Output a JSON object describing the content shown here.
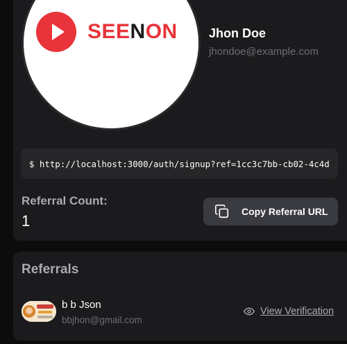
{
  "profile": {
    "logo": {
      "text_red_1": "SEE",
      "text_dark": "N",
      "text_red_2": "ON"
    },
    "name": "Jhon Doe",
    "email": "jhondoe@example.com",
    "referral_url": "$ http://localhost:3000/auth/signup?ref=1cc3c7bb-cb02-4c4d",
    "referral_count_label": "Referral Count:",
    "referral_count": "1",
    "copy_button_label": "Copy Referral URL",
    "copy_icon": "copy-icon"
  },
  "referrals": {
    "title": "Referrals",
    "items": [
      {
        "name": "b b Json",
        "email": "bbjhon@gmail.com",
        "action_label": "View Verification",
        "action_icon": "eye-icon"
      }
    ]
  },
  "colors": {
    "background": "#0c0c0d",
    "card": "#1b1b1d",
    "brand_red": "#e8343a",
    "button": "#3a3b40"
  }
}
